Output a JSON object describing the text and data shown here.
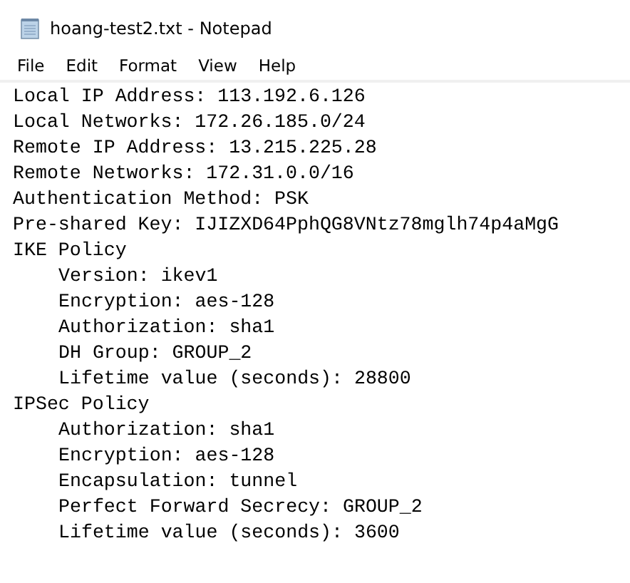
{
  "window": {
    "title": "hoang-test2.txt - Notepad"
  },
  "menu": [
    "File",
    "Edit",
    "Format",
    "View",
    "Help"
  ],
  "lines": [
    {
      "text": "Local IP Address: 113.192.6.126"
    },
    {
      "text": "Local Networks: 172.26.185.0/24"
    },
    {
      "text": "Remote IP Address: 13.215.225.28"
    },
    {
      "text": "Remote Networks: 172.31.0.0/16"
    },
    {
      "text": "Authentication Method: PSK"
    },
    {
      "text": "Pre-shared Key: IJIZXD64PphQG8VNtz78mglh74p4aMgG"
    },
    {
      "text": "IKE Policy",
      "children": [
        {
          "text": "Version: ikev1"
        },
        {
          "text": "Encryption: aes-128"
        },
        {
          "text": "Authorization: sha1"
        },
        {
          "text": "DH Group: GROUP_2"
        },
        {
          "text": "Lifetime value (seconds): 28800"
        }
      ]
    },
    {
      "text": "IPSec Policy",
      "children": [
        {
          "text": "Authorization: sha1"
        },
        {
          "text": "Encryption: aes-128"
        },
        {
          "text": "Encapsulation: tunnel"
        },
        {
          "text": "Perfect Forward Secrecy: GROUP_2"
        },
        {
          "text": "Lifetime value (seconds): 3600"
        }
      ]
    }
  ]
}
